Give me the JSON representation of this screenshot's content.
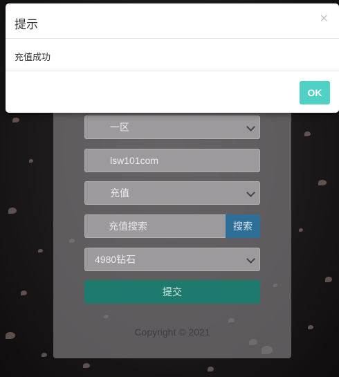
{
  "modal": {
    "title": "提示",
    "close_symbol": "×",
    "message": "充值成功",
    "ok_label": "OK"
  },
  "form": {
    "region_select": "一区",
    "account_value": "lsw101com",
    "type_select": "充值",
    "search": {
      "placeholder": "充值搜索",
      "button_label": "搜索"
    },
    "package_select": "4980钻石",
    "submit_label": "提交"
  },
  "footer": {
    "copyright": "Copyright © 2021"
  },
  "colors": {
    "ok_button": "#4fd1c5",
    "search_button": "#2e6f9a",
    "submit_button": "#1e7a6c"
  }
}
